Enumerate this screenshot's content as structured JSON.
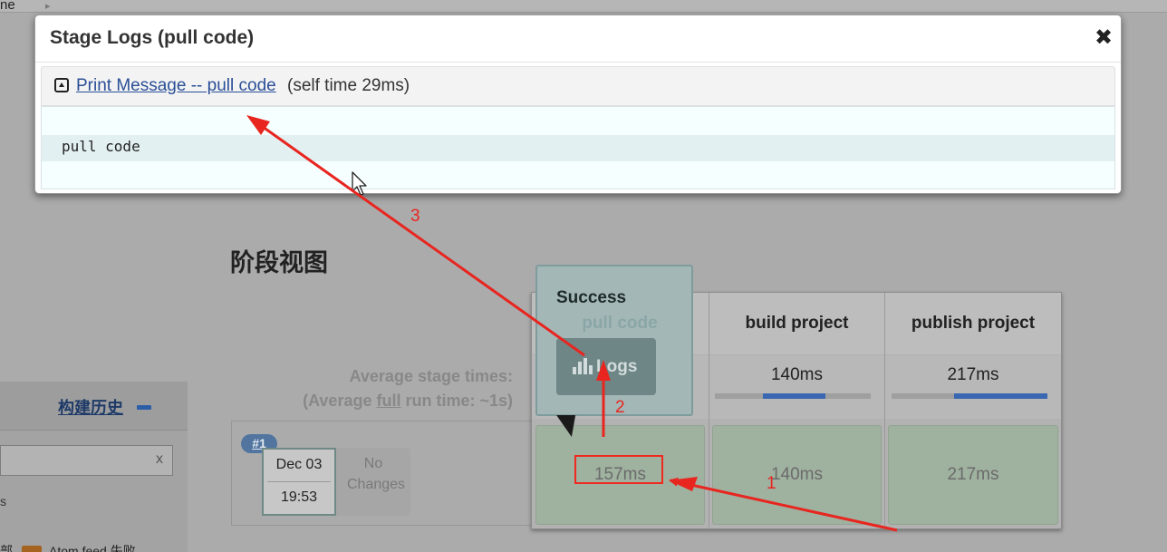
{
  "breadcrumb": {
    "item": "ne"
  },
  "modal": {
    "title": "Stage Logs (pull code)",
    "close_glyph": "✖",
    "step_link": "Print Message -- pull code ",
    "step_selftime": "(self time 29ms)",
    "console_output": "pull code"
  },
  "stage_view": {
    "title": "阶段视图",
    "avg_label_line1": "Average stage times:",
    "avg_label_line2_prefix": "(Average ",
    "avg_label_line2_underlined": "full",
    "avg_label_line2_suffix": " run time: ~1s)",
    "stages": [
      {
        "name": "pull code",
        "avg": "",
        "progress": null
      },
      {
        "name": "build project",
        "avg": "140ms",
        "progress": 0.4
      },
      {
        "name": "publish project",
        "avg": "217ms",
        "progress": 0.6
      }
    ],
    "build": {
      "number": "#1",
      "date": "Dec 03",
      "time": "19:53",
      "changes": "No Changes",
      "cells": [
        "157ms",
        "140ms",
        "217ms"
      ]
    }
  },
  "popover": {
    "status": "Success",
    "stage": "pull code",
    "logs_button": "Logs"
  },
  "sidebar": {
    "title": "构建历史",
    "filter_clear": "x",
    "partial_text": "s",
    "row_text_left": "部",
    "row_text_right": "Atom feed 失败"
  },
  "annotations": {
    "n1": "1",
    "n2": "2",
    "n3": "3"
  },
  "colors": {
    "annotation": "#e8251f",
    "link": "#2b4f97",
    "success_cell": "#9fb19f",
    "progress": "#3a67b1"
  }
}
